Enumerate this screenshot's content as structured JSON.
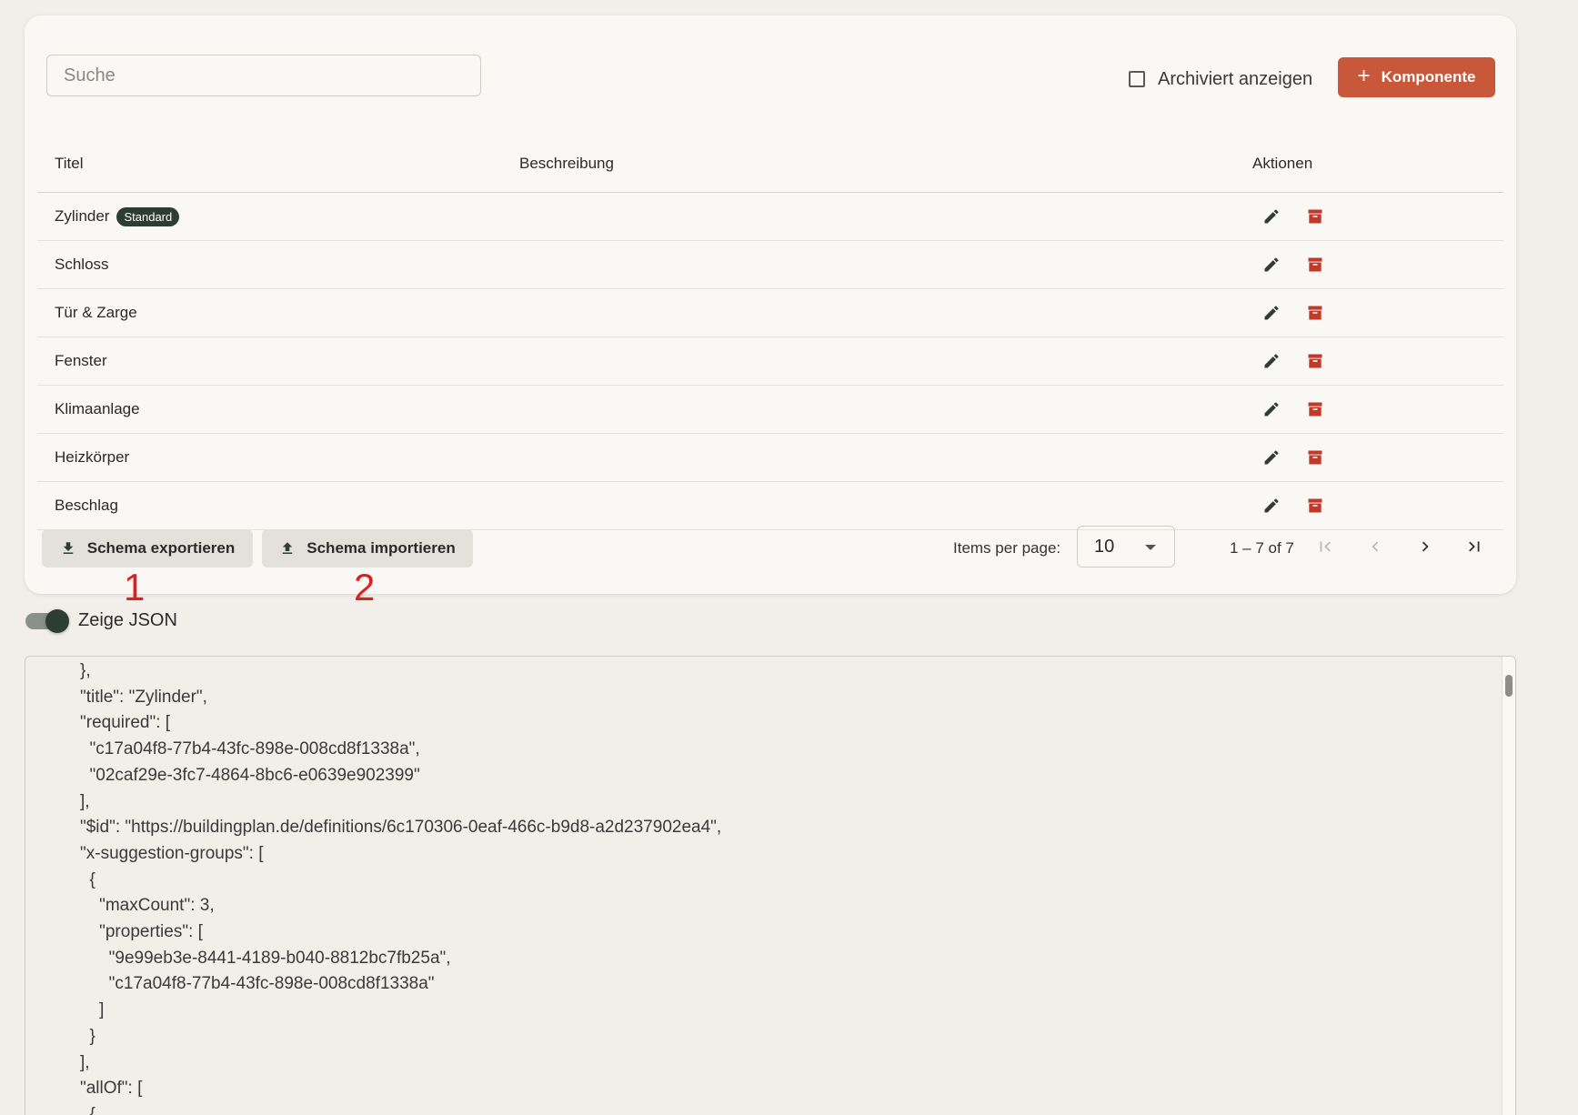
{
  "search": {
    "placeholder": "Suche"
  },
  "toolbar": {
    "show_archived_label": "Archiviert anzeigen",
    "add_label": "Komponente"
  },
  "table": {
    "headers": {
      "title": "Titel",
      "description": "Beschreibung",
      "actions": "Aktionen"
    },
    "rows": [
      {
        "title": "Zylinder",
        "badge": "Standard",
        "description": ""
      },
      {
        "title": "Schloss",
        "description": ""
      },
      {
        "title": "Tür & Zarge",
        "description": ""
      },
      {
        "title": "Fenster",
        "description": ""
      },
      {
        "title": "Klimaanlage",
        "description": ""
      },
      {
        "title": "Heizkörper",
        "description": ""
      },
      {
        "title": "Beschlag",
        "description": ""
      }
    ]
  },
  "footer": {
    "export_label": "Schema exportieren",
    "import_label": "Schema importieren",
    "annotation_1": "1",
    "annotation_2": "2",
    "items_per_page_label": "Items per page:",
    "items_per_page_value": "10",
    "range": "1 – 7 of 7"
  },
  "json_toggle": {
    "label": "Zeige JSON",
    "on": true
  },
  "json_view": {
    "text": "},\n\"title\": \"Zylinder\",\n\"required\": [\n  \"c17a04f8-77b4-43fc-898e-008cd8f1338a\",\n  \"02caf29e-3fc7-4864-8bc6-e0639e902399\"\n],\n\"$id\": \"https://buildingplan.de/definitions/6c170306-0eaf-466c-b9d8-a2d237902ea4\",\n\"x-suggestion-groups\": [\n  {\n    \"maxCount\": 3,\n    \"properties\": [\n      \"9e99eb3e-8441-4189-b040-8812bc7fb25a\",\n      \"c17a04f8-77b4-43fc-898e-008cd8f1338a\"\n    ]\n  }\n],\n\"allOf\": [\n  {"
  },
  "colors": {
    "accent": "#c9573a",
    "archive_icon": "#c0392b",
    "badge_bg": "#2e3d33",
    "background": "#f2efea",
    "card": "#faf8f5"
  },
  "icons": {
    "edit": "pencil-icon",
    "archive": "archive-icon",
    "download": "download-icon",
    "upload": "upload-icon"
  }
}
